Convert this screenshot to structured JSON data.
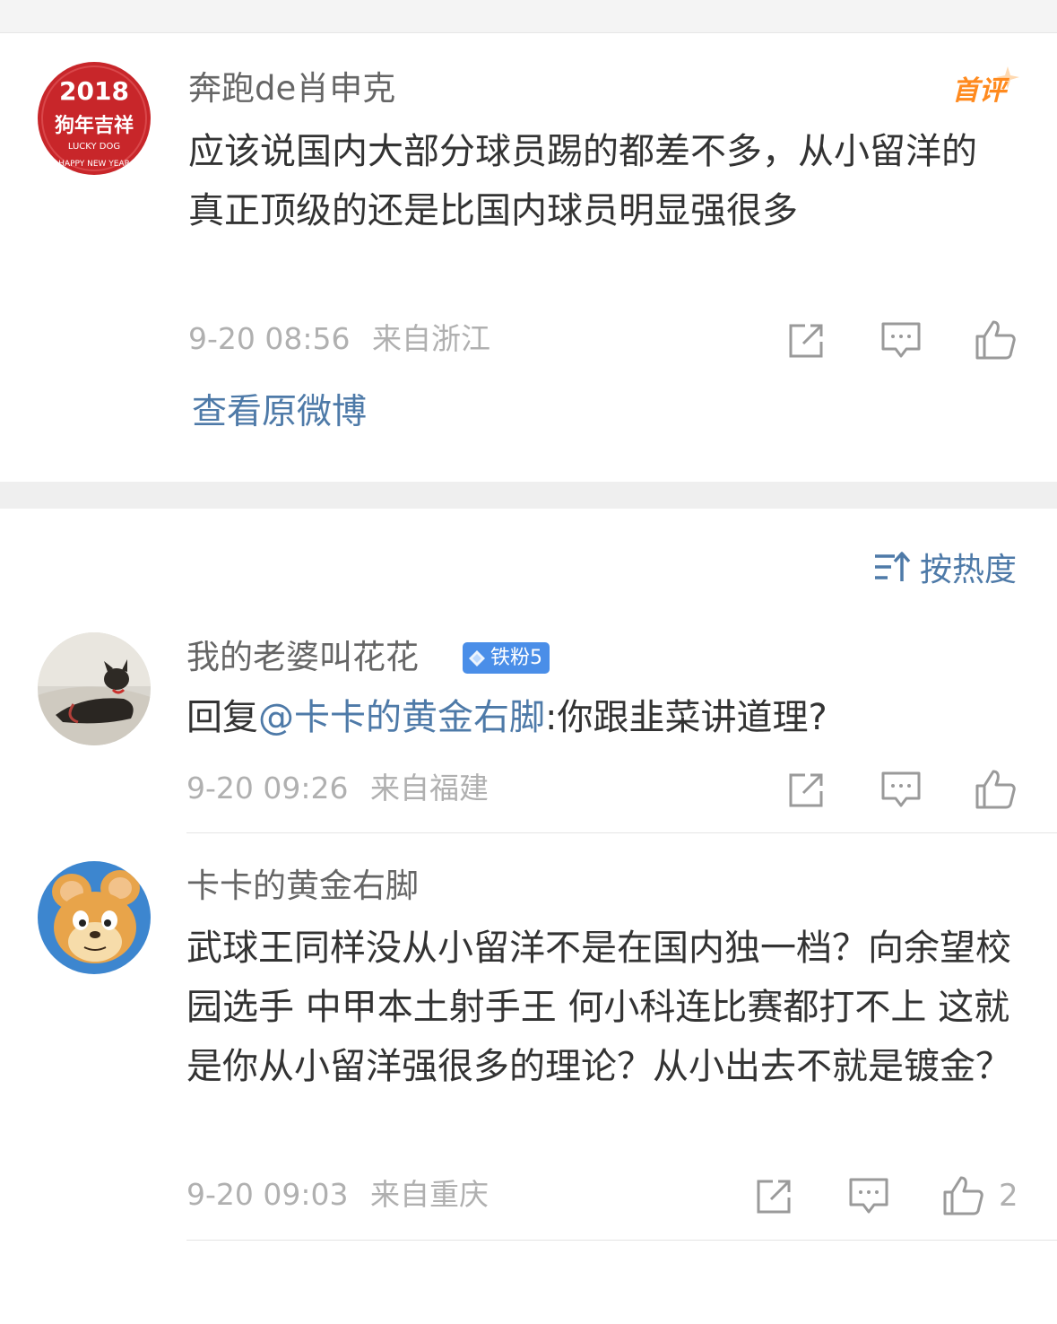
{
  "original_post": {
    "username": "奔跑de肖申克",
    "first_comment_badge": "首评",
    "avatar": {
      "year": "2018",
      "title": "狗年吉祥",
      "subtitle": "LUCKY DOG",
      "footer": "HAPPY NEW YEAR"
    },
    "content": "应该说国内大部分球员踢的都差不多，从小留洋的真正顶级的还是比国内球员明显强很多",
    "time": "9-20 08:56",
    "location": "来自浙江",
    "view_original": "查看原微博"
  },
  "sort": {
    "label": "按热度",
    "icon": "sort-icon"
  },
  "comments": [
    {
      "username": "我的老婆叫花花",
      "fan_badge": "铁粉5",
      "reply_prefix": "回复",
      "mention": "@卡卡的黄金右脚",
      "content": ":你跟韭菜讲道理?",
      "time": "9-20 09:26",
      "location": "来自福建"
    },
    {
      "username": "卡卡的黄金右脚",
      "content": "武球王同样没从小留洋不是在国内独一档？向余望校园选手 中甲本土射手王 何小科连比赛都打不上 这就是你从小留洋强很多的理论？从小出去不就是镀金？",
      "time": "9-20 09:03",
      "location": "来自重庆",
      "like_count": "2"
    }
  ],
  "icons": [
    "share-icon",
    "comment-icon",
    "like-icon"
  ],
  "colors": {
    "link": "#4e7aa8",
    "badge_orange": "#ff8a1e",
    "fan_badge_blue": "#4a8ee8",
    "meta_gray": "#b0b0b0"
  }
}
